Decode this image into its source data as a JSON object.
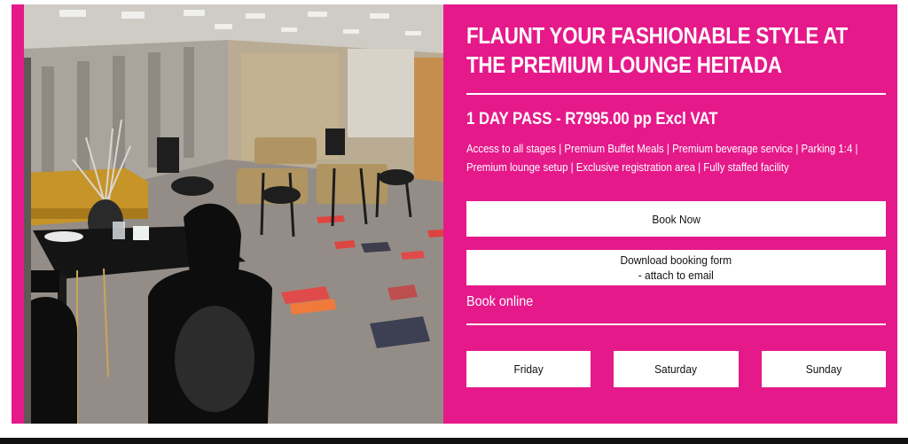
{
  "photo": {
    "alt": "Premium lounge event hall with black chairs and gold cocktail tables"
  },
  "headline": {
    "line1": "FLAUNT YOUR FASHIONABLE STYLE AT",
    "line2": "THE PREMIUM LOUNGE HEITADA"
  },
  "pass": {
    "title": "1 DAY PASS - R7995.00 pp Excl VAT",
    "description": "Access to all stages | Premium Buffet Meals | Premium beverage service | Parking 1:4 | Premium lounge setup | Exclusive registration area | Fully staffed facility"
  },
  "buttons": {
    "book_now": "Book Now",
    "download_line1": "Download booking form",
    "download_line2": "- attach to email"
  },
  "book_online": "Book online",
  "days": [
    "Friday",
    "Saturday",
    "Sunday"
  ],
  "colors": {
    "accent": "#e5198a",
    "button_bg": "#ffffff",
    "text_light": "#ffffff",
    "text_dark": "#111111"
  }
}
